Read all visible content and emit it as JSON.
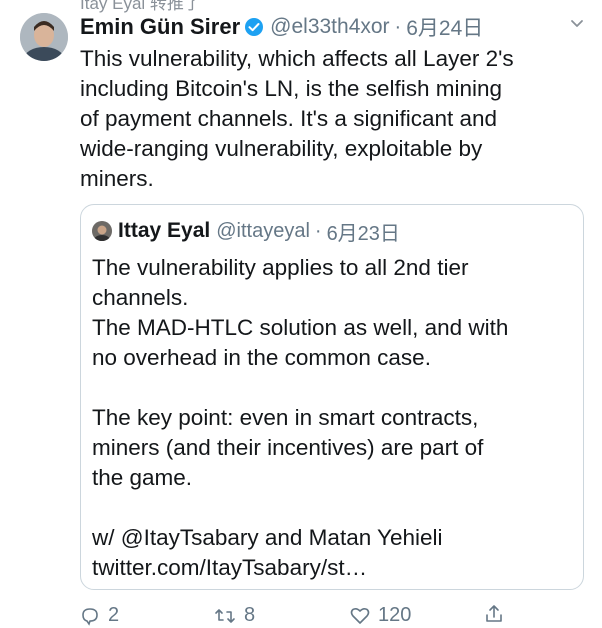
{
  "retweet_line": "Itay Eyal 转推了",
  "tweet": {
    "author_name": "Emin Gün Sirer",
    "handle": "@el33th4xor",
    "separator": "·",
    "date": "6月24日",
    "text_lines": [
      "This vulnerability, which affects all Layer 2's",
      "including Bitcoin's LN, is the selfish mining",
      "of payment channels. It's a significant and",
      "wide-ranging vulnerability, exploitable by",
      "miners."
    ]
  },
  "quoted_tweet": {
    "author_name": "Ittay Eyal",
    "handle": "@ittayeyal",
    "separator": "·",
    "date": "6月23日",
    "text_lines": [
      "The vulnerability applies to all 2nd tier",
      "channels.",
      "The MAD-HTLC solution as well, and with",
      "no overhead in the common case.",
      "",
      "The key point: even in smart contracts,",
      "miners (and their incentives) are part of",
      "the game.",
      "",
      "w/ @ItayTsabary and Matan Yehieli",
      "twitter.com/ItayTsabary/st…"
    ]
  },
  "actions": {
    "reply_count": "2",
    "retweet_count": "8",
    "like_count": "120"
  },
  "icons": {
    "verified": "verified-badge-icon",
    "caret": "chevron-down-icon",
    "reply": "reply-icon",
    "retweet": "retweet-icon",
    "like": "heart-icon",
    "share": "share-icon"
  },
  "colors": {
    "verified_blue": "#1da1f2",
    "secondary_text": "#657786",
    "border": "#ccd6dd"
  }
}
